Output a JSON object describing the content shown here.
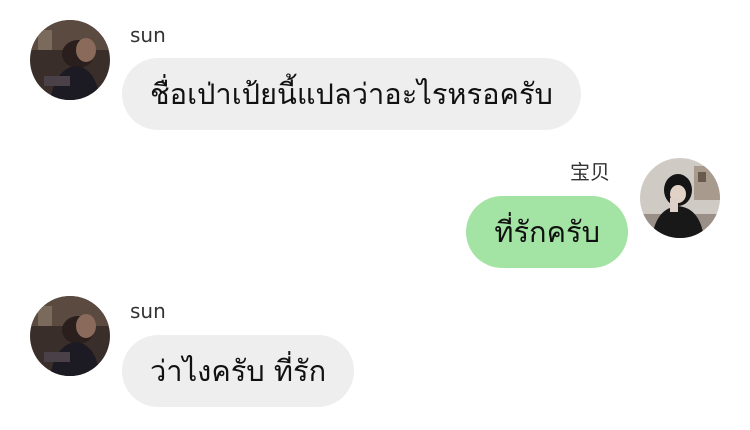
{
  "theme": {
    "incoming_bubble_color": "#eeeeee",
    "outgoing_bubble_color": "#a3e3a3",
    "background_color": "#ffffff"
  },
  "messages": [
    {
      "sender": "sun",
      "direction": "incoming",
      "text": "ชื่อเป่าเป้ยนี้แปลว่าอะไรหรอครับ",
      "avatar_icon": "user-avatar-photo"
    },
    {
      "sender": "宝贝",
      "direction": "outgoing",
      "text": "ที่รักครับ",
      "avatar_icon": "user-avatar-photo"
    },
    {
      "sender": "sun",
      "direction": "incoming",
      "text": "ว่าไงครับ ที่รัก",
      "avatar_icon": "user-avatar-photo"
    }
  ]
}
